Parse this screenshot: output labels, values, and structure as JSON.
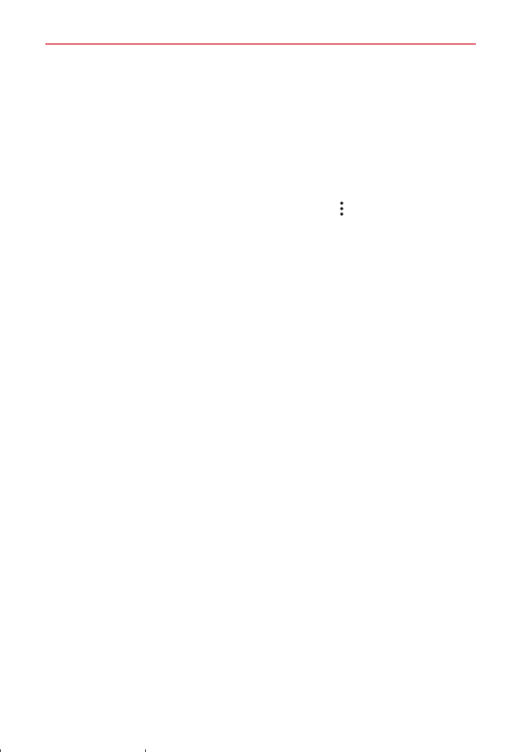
{
  "colors": {
    "header_rule": "#d0021b",
    "icon": "#222222",
    "background": "#ffffff"
  },
  "icons": {
    "more_options": "more-vertical-icon"
  }
}
